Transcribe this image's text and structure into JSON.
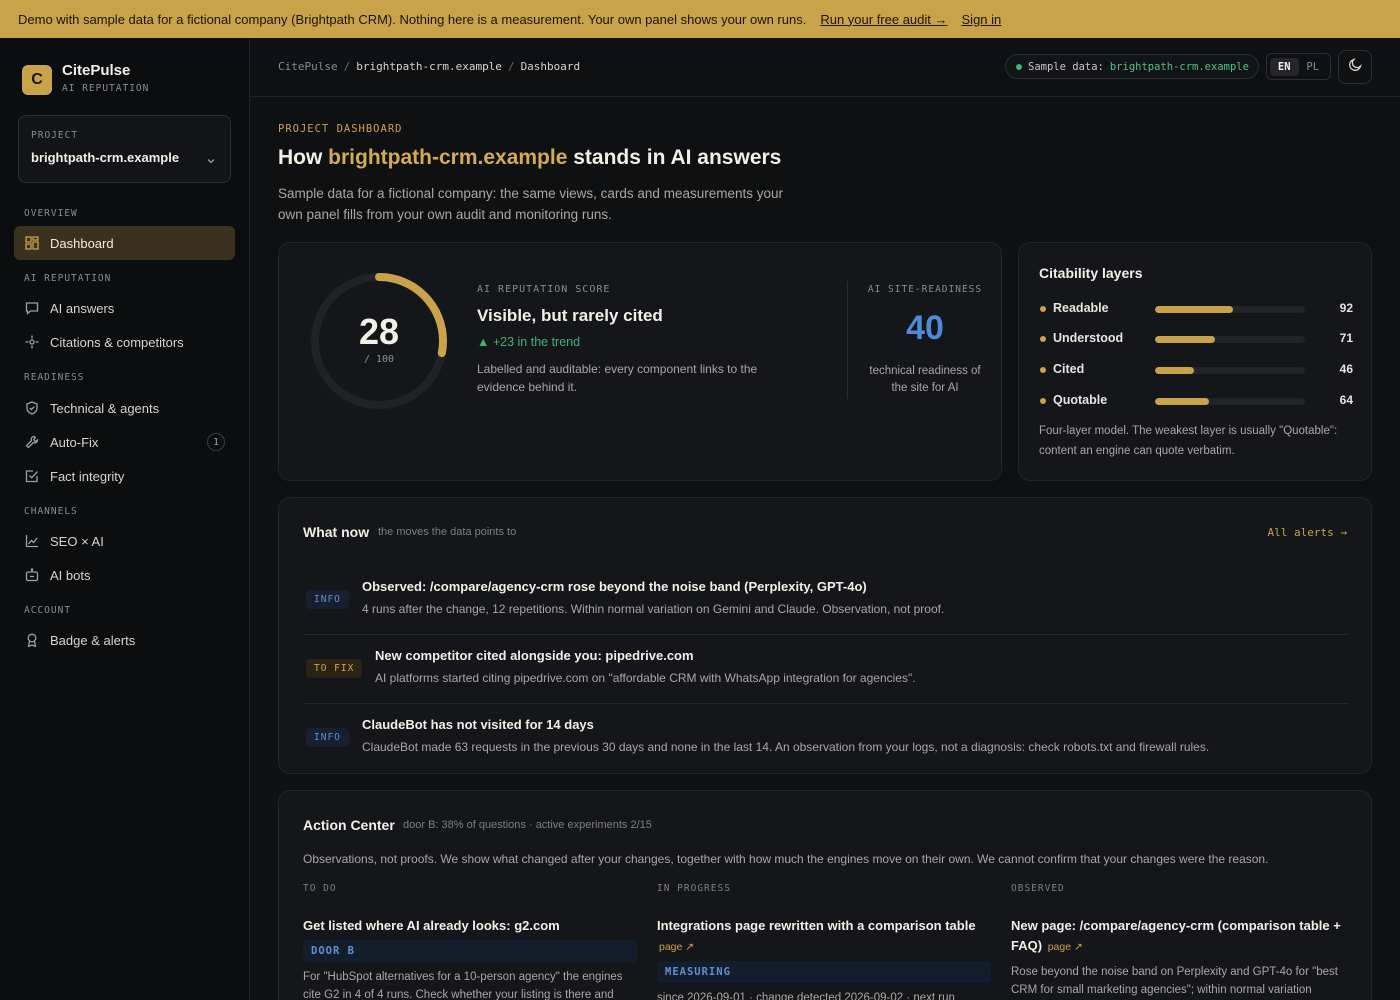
{
  "banner": {
    "message": "Demo with sample data for a fictional company (Brightpath CRM). Nothing here is a measurement. Your own panel shows your own runs.",
    "cta": "Run your free audit →",
    "signin": "Sign in"
  },
  "brand": {
    "logo_letter": "C",
    "name": "CitePulse",
    "subtitle": "AI REPUTATION"
  },
  "project": {
    "label": "PROJECT",
    "value": "brightpath-crm.example"
  },
  "nav": {
    "overview": "OVERVIEW",
    "dashboard": "Dashboard",
    "ai_reputation": "AI REPUTATION",
    "ai_answers": "AI answers",
    "citations": "Citations & competitors",
    "readiness": "READINESS",
    "technical": "Technical & agents",
    "autofix": "Auto-Fix",
    "autofix_badge": "1",
    "fact": "Fact integrity",
    "channels": "CHANNELS",
    "seo": "SEO × AI",
    "bots": "AI bots",
    "account": "ACCOUNT",
    "badge": "Badge & alerts"
  },
  "topbar": {
    "crumb_root": "CitePulse",
    "crumb_domain": "brightpath-crm.example",
    "crumb_page": "Dashboard",
    "sample_label": "Sample data:",
    "sample_domain": "brightpath-crm.example",
    "lang_en": "EN",
    "lang_pl": "PL"
  },
  "header": {
    "eyebrow": "PROJECT DASHBOARD",
    "title_pre": "How ",
    "title_domain": "brightpath-crm.example",
    "title_post": " stands in AI answers",
    "intro": "Sample data for a fictional company: the same views, cards and measurements your own panel fills from your own audit and monitoring runs."
  },
  "score": {
    "value": "28",
    "max": "/ 100",
    "fraction": 0.28,
    "eyebrow": "AI REPUTATION SCORE",
    "title": "Visible, but rarely cited",
    "trend": "▲ +23 in the trend",
    "desc": "Labelled and auditable: every component links to the evidence behind it.",
    "readiness_eyebrow": "AI SITE-READINESS",
    "readiness_value": "40",
    "readiness_desc": "technical readiness of the site for AI"
  },
  "layers": {
    "title": "Citability layers",
    "items": [
      {
        "name": "Readable",
        "value": "92",
        "fraction": 0.52
      },
      {
        "name": "Understood",
        "value": "71",
        "fraction": 0.4
      },
      {
        "name": "Cited",
        "value": "46",
        "fraction": 0.26
      },
      {
        "name": "Quotable",
        "value": "64",
        "fraction": 0.36
      }
    ],
    "note": "Four-layer model. The weakest layer is usually \"Quotable\": content an engine can quote verbatim."
  },
  "now": {
    "title": "What now",
    "subtitle": "the moves the data points to",
    "link": "All alerts →",
    "alerts": [
      {
        "tag": "INFO",
        "title": "Observed: /compare/agency-crm rose beyond the noise band (Perplexity, GPT-4o)",
        "desc": "4 runs after the change, 12 repetitions. Within normal variation on Gemini and Claude. Observation, not proof."
      },
      {
        "tag": "TO FIX",
        "title": "New competitor cited alongside you: pipedrive.com",
        "desc": "AI platforms started citing pipedrive.com on \"affordable CRM with WhatsApp integration for agencies\"."
      },
      {
        "tag": "INFO",
        "title": "ClaudeBot has not visited for 14 days",
        "desc": "ClaudeBot made 63 requests in the previous 30 days and none in the last 14. An observation from your logs, not a diagnosis: check robots.txt and firewall rules."
      }
    ]
  },
  "action": {
    "title": "Action Center",
    "subtitle": "door B: 38% of questions · active experiments 2/15",
    "note": "Observations, not proofs. We show what changed after your changes, together with how much the engines move on their own. We cannot confirm that your changes were the reason.",
    "todo_head": "TO DO",
    "todo_title": "Get listed where AI already looks: g2.com",
    "todo_status": "DOOR B",
    "todo_text": "For \"HubSpot alternatives for a 10-person agency\" the engines cite G2 in 4 of 4 runs. Check whether your listing is there and",
    "progress_head": "IN PROGRESS",
    "progress_title": "Integrations page rewritten with a comparison table",
    "progress_page": "page ↗",
    "progress_status": "MEASURING",
    "progress_text": "since 2026-09-01 · change detected 2026-09-02 · next run",
    "observed_head": "OBSERVED",
    "observed_title": "New page: /compare/agency-crm (comparison table + FAQ)",
    "observed_page": "page ↗",
    "observed_text": "Rose beyond the noise band on Perplexity and GPT-4o for \"best CRM for small marketing agencies\"; within normal variation elsewhere."
  },
  "colors": {
    "accent": "#c9a34a",
    "green": "#3fb27a",
    "blue": "#4f8ad6"
  }
}
